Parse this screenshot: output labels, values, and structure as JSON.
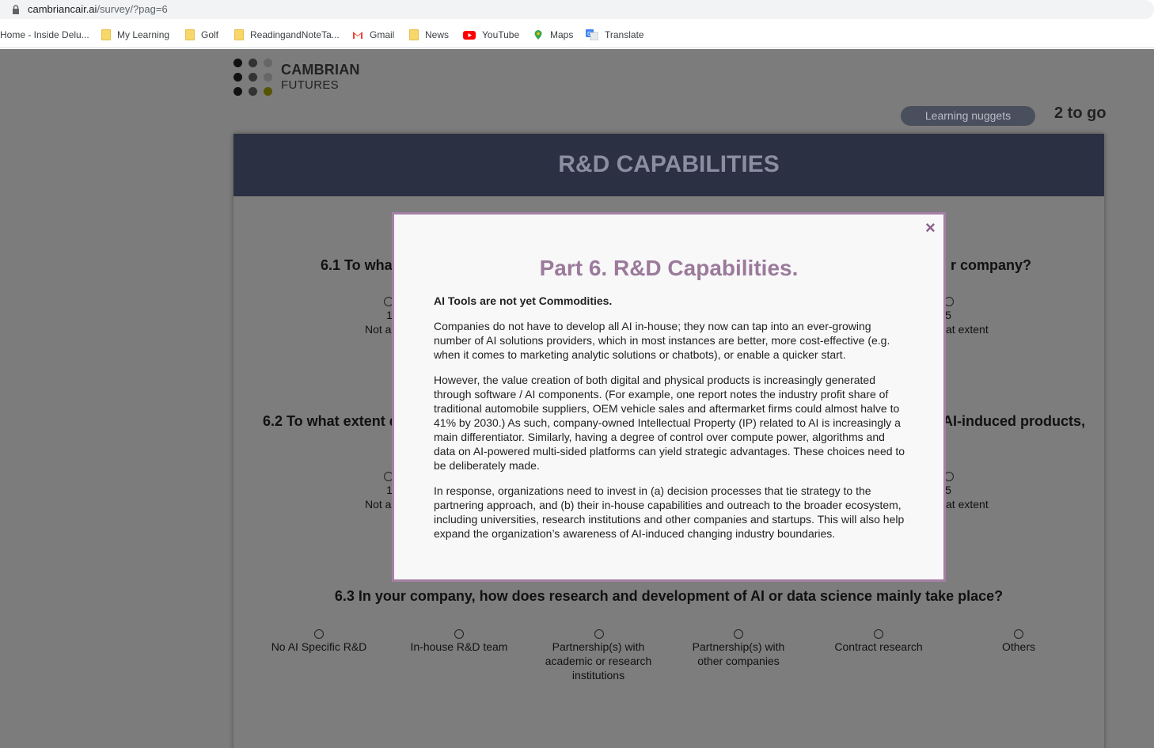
{
  "browser": {
    "url_host": "cambriancair.ai",
    "url_path": "/survey/?pag=6",
    "bookmarks": [
      {
        "label": "Home - Inside Delu...",
        "icon": "page-icon"
      },
      {
        "label": "My Learning",
        "icon": "folder-icon"
      },
      {
        "label": "Golf",
        "icon": "folder-icon"
      },
      {
        "label": "ReadingandNoteTa...",
        "icon": "folder-icon"
      },
      {
        "label": "Gmail",
        "icon": "gmail-icon"
      },
      {
        "label": "News",
        "icon": "folder-icon"
      },
      {
        "label": "YouTube",
        "icon": "youtube-icon"
      },
      {
        "label": "Maps",
        "icon": "maps-icon"
      },
      {
        "label": "Translate",
        "icon": "translate-icon"
      }
    ]
  },
  "brand": {
    "line1": "CAMBRIAN",
    "line2": "FUTURES",
    "accent": "#c8c800"
  },
  "header": {
    "nuggets_label": "Learning nuggets",
    "progress_text": "2 to go"
  },
  "section": {
    "title": "R&D CAPABILITIES"
  },
  "questions": {
    "q1": {
      "left": "6.1  To wha",
      "right": "r company?",
      "scale_min_num": "1",
      "scale_min_label": "Not a",
      "scale_max_num": "5",
      "scale_max_label": "at extent"
    },
    "q2": {
      "left": "6.2 To what extent d",
      "right": "AI-induced products,",
      "scale_min_num": "1",
      "scale_min_label": "Not a",
      "scale_max_num": "5",
      "scale_max_label": "at extent"
    },
    "q3": {
      "text": "6.3 In your company, how does research and development of AI or data science mainly take place?",
      "options": [
        "No AI Specific R&D",
        "In-house R&D team",
        "Partnership(s) with academic or research institutions",
        "Partnership(s) with other companies",
        "Contract research",
        "Others"
      ]
    }
  },
  "modal": {
    "close_glyph": "×",
    "title": "Part 6. R&D Capabilities.",
    "lead": "AI Tools are not yet Commodities.",
    "paragraphs": [
      "Companies do not have to develop all AI in-house; they now can tap into an ever-growing number of AI solutions providers, which in most instances are better, more cost-effective (e.g. when it comes to marketing analytic solutions or chatbots), or enable a quicker start.",
      "However, the value creation of both digital and physical products is increasingly generated through software / AI components. (For example, one report notes the industry profit share of traditional automobile suppliers, OEM vehicle sales and aftermarket firms could almost halve to 41% by 2030.) As such, company-owned Intellectual Property (IP) related to AI is increasingly a main differentiator. Similarly, having a degree of control over compute power, algorithms and data on AI-powered multi-sided platforms can yield strategic advantages. These choices need to be deliberately made.",
      "In response, organizations need to invest in (a) decision processes that tie strategy to the partnering approach, and (b) their in-house capabilities and outreach to the broader ecosystem, including universities, research institutions and other companies and startups. This will also help expand the organization’s awareness of AI-induced changing industry boundaries."
    ]
  }
}
